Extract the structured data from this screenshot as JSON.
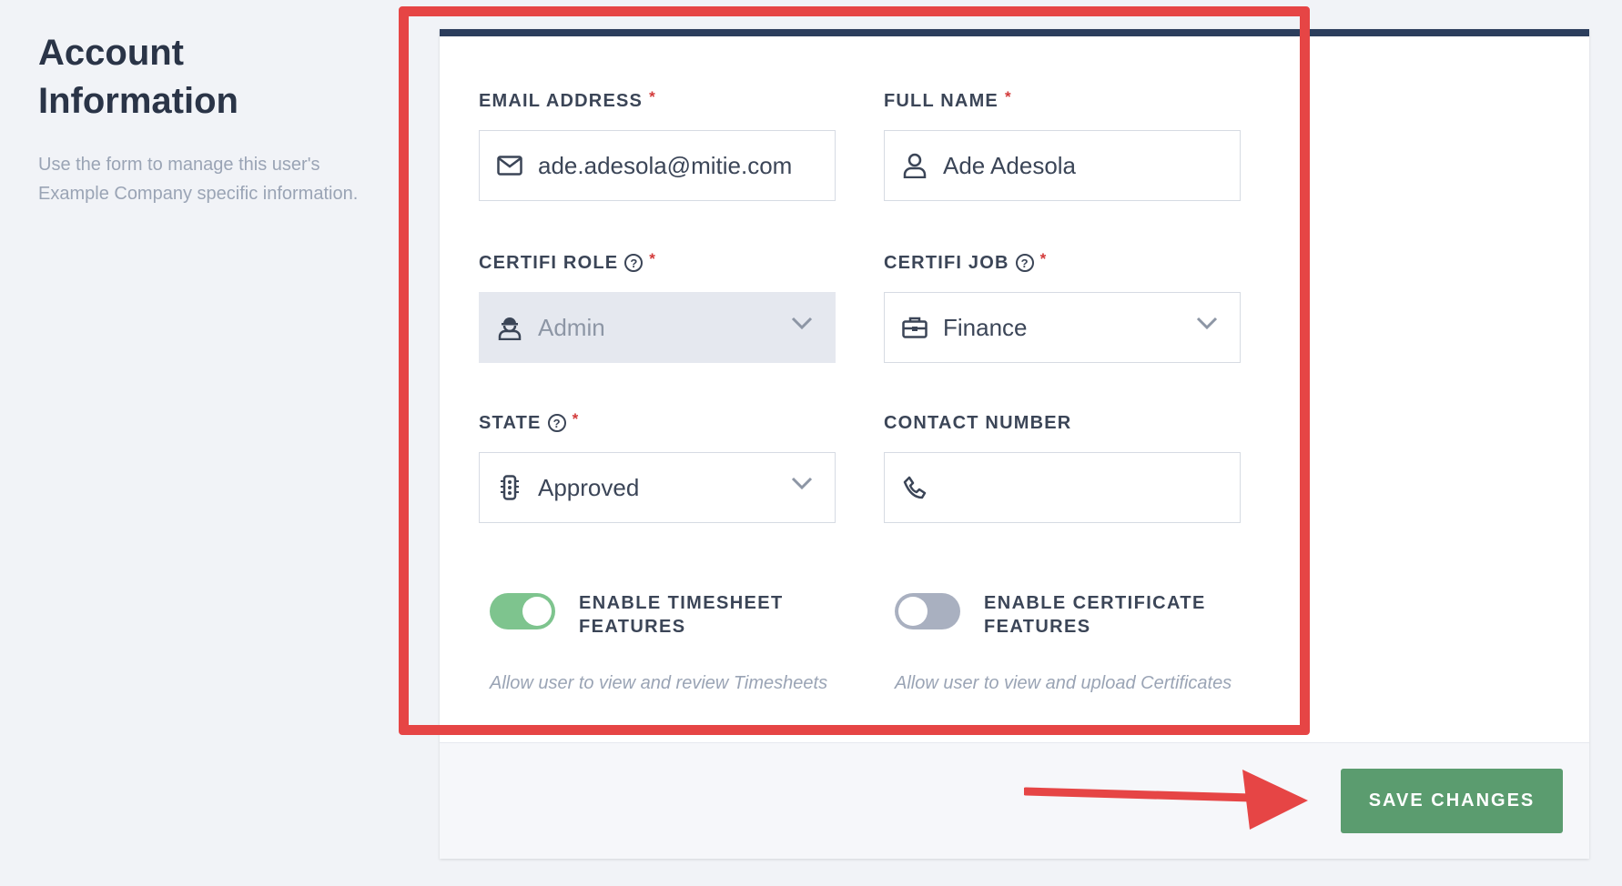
{
  "sidebar": {
    "title": "Account Information",
    "description": "Use the form to manage this user's Example Company specific information."
  },
  "form": {
    "email": {
      "label": "EMAIL ADDRESS",
      "required": "*",
      "value": "ade.adesola@mitie.com",
      "icon": "envelope-icon"
    },
    "full_name": {
      "label": "FULL NAME",
      "required": "*",
      "value": "Ade Adesola",
      "icon": "user-icon"
    },
    "role": {
      "label": "CERTIFI ROLE",
      "required": "*",
      "help": "?",
      "value": "Admin",
      "icon": "worker-icon",
      "disabled": true
    },
    "job": {
      "label": "CERTIFI JOB",
      "required": "*",
      "help": "?",
      "value": "Finance",
      "icon": "briefcase-icon"
    },
    "state": {
      "label": "STATE",
      "required": "*",
      "help": "?",
      "value": "Approved",
      "icon": "traffic-light-icon"
    },
    "contact": {
      "label": "CONTACT NUMBER",
      "value": "",
      "icon": "phone-icon"
    }
  },
  "toggles": {
    "timesheet": {
      "label": "ENABLE TIMESHEET FEATURES",
      "description": "Allow user to view and review Timesheets",
      "enabled": true
    },
    "certificate": {
      "label": "ENABLE CERTIFICATE FEATURES",
      "description": "Allow user to view and upload Certificates",
      "enabled": false
    }
  },
  "footer": {
    "save_label": "SAVE CHANGES"
  },
  "colors": {
    "accent_navy": "#2b3d5c",
    "save_green": "#5b9c6f",
    "toggle_on": "#7ec48e",
    "toggle_off": "#a9b0c0",
    "required_red": "#d33a3a",
    "annotation_red": "#e64545"
  }
}
